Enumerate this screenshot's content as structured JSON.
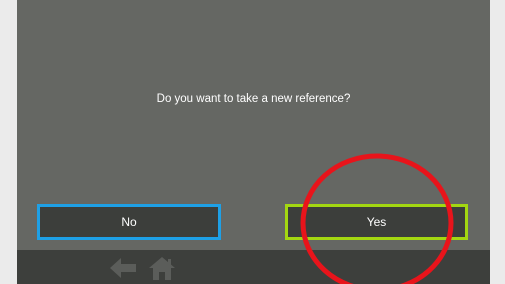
{
  "dialog": {
    "message": "Do you want to take a new reference?",
    "no_label": "No",
    "yes_label": "Yes"
  },
  "navbar": {
    "icons": [
      "back-arrow-icon",
      "home-icon"
    ]
  },
  "colors": {
    "screen_background": "#656763",
    "button_background": "#3c3e3b",
    "no_border": "#1ea0e6",
    "yes_border": "#a3d711",
    "navbar_background": "#3d3f3c",
    "nav_icon": "#5b5d5a",
    "annotation_circle": "#e8141b"
  }
}
